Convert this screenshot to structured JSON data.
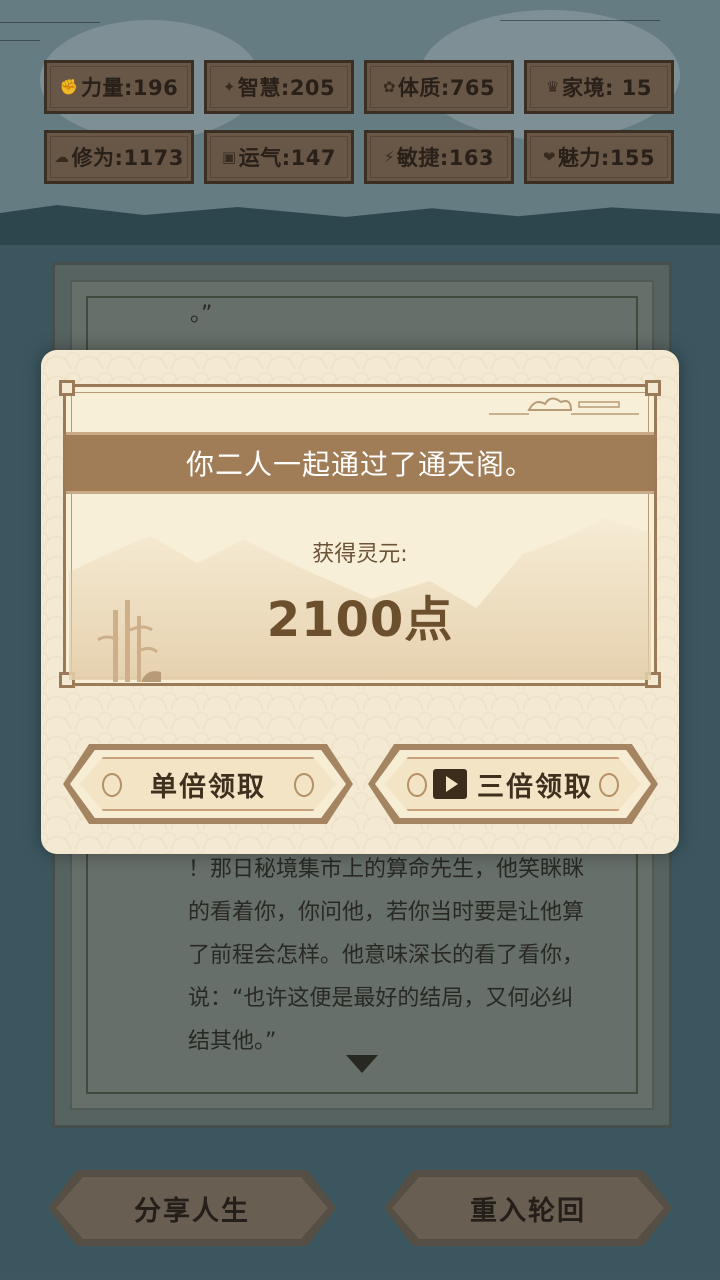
{
  "stats": [
    {
      "icon": "fist-icon",
      "glyph": "✊",
      "label": "力量:196"
    },
    {
      "icon": "bulb-icon",
      "glyph": "✦",
      "label": "智慧:205"
    },
    {
      "icon": "gear-icon",
      "glyph": "✿",
      "label": "体质:765"
    },
    {
      "icon": "family-icon",
      "glyph": "♛",
      "label": "家境: 15"
    },
    {
      "icon": "cloud-icon",
      "glyph": "☁",
      "label": "修为:1173"
    },
    {
      "icon": "luck-icon",
      "glyph": "▣",
      "label": "运气:147"
    },
    {
      "icon": "lightning-icon",
      "glyph": "⚡",
      "label": "敏捷:163"
    },
    {
      "icon": "heart-icon",
      "glyph": "❤",
      "label": "魅力:155"
    }
  ],
  "story": {
    "top_fragment": "。”",
    "lines": [
      "！那日秘境集市上的算命先生，他笑眯眯",
      "的看着你，你问他，若你当时要是让他算",
      "了前程会怎样。他意味深长的看了看你，",
      "说：“也许这便是最好的结局，又何必纠",
      "结其他。”"
    ]
  },
  "bottom_buttons": {
    "share": "分享人生",
    "rebirth": "重入轮回"
  },
  "modal": {
    "title": "你二人一起通过了通天阁。",
    "reward_label": "获得灵元:",
    "reward_value": "2100点",
    "single_button": "单倍领取",
    "triple_button": "三倍领取"
  }
}
